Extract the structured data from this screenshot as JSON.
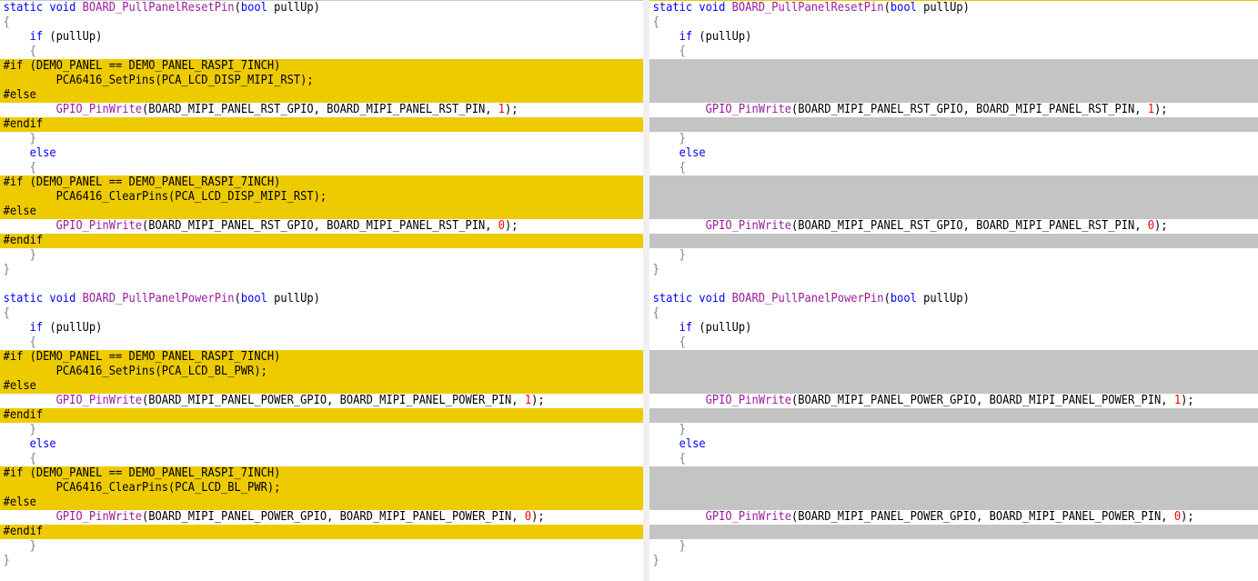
{
  "left": {
    "lines": [
      {
        "kind": "normal",
        "segs": [
          {
            "t": "static void ",
            "c": "kw"
          },
          {
            "t": "BOARD_PullPanelResetPin",
            "c": "fn"
          },
          {
            "t": "(",
            "c": ""
          },
          {
            "t": "bool",
            "c": "kw"
          },
          {
            "t": " pullUp)",
            "c": ""
          }
        ]
      },
      {
        "kind": "normal",
        "segs": [
          {
            "t": "{",
            "c": "gray"
          }
        ]
      },
      {
        "kind": "normal",
        "segs": [
          {
            "t": "    if",
            "c": "kw"
          },
          {
            "t": " (pullUp)",
            "c": ""
          }
        ]
      },
      {
        "kind": "normal",
        "segs": [
          {
            "t": "    {",
            "c": "gray"
          }
        ]
      },
      {
        "kind": "changed",
        "segs": [
          {
            "t": "#if (DEMO_PANEL == DEMO_PANEL_RASPI_7INCH)",
            "c": ""
          }
        ]
      },
      {
        "kind": "changed",
        "segs": [
          {
            "t": "        PCA6416_SetPins(PCA_LCD_DISP_MIPI_RST);",
            "c": ""
          }
        ]
      },
      {
        "kind": "changed",
        "segs": [
          {
            "t": "#else",
            "c": ""
          }
        ]
      },
      {
        "kind": "normal",
        "segs": [
          {
            "t": "        ",
            "c": ""
          },
          {
            "t": "GPIO_PinWrite",
            "c": "fn"
          },
          {
            "t": "(BOARD_MIPI_PANEL_RST_GPIO, BOARD_MIPI_PANEL_RST_PIN, ",
            "c": ""
          },
          {
            "t": "1",
            "c": "num"
          },
          {
            "t": ");",
            "c": ""
          }
        ]
      },
      {
        "kind": "changed",
        "segs": [
          {
            "t": "#endif",
            "c": ""
          }
        ]
      },
      {
        "kind": "normal",
        "segs": [
          {
            "t": "    }",
            "c": "gray"
          }
        ]
      },
      {
        "kind": "normal",
        "segs": [
          {
            "t": "    else",
            "c": "kw"
          }
        ]
      },
      {
        "kind": "normal",
        "segs": [
          {
            "t": "    {",
            "c": "gray"
          }
        ]
      },
      {
        "kind": "changed",
        "segs": [
          {
            "t": "#if (DEMO_PANEL == DEMO_PANEL_RASPI_7INCH)",
            "c": ""
          }
        ]
      },
      {
        "kind": "changed",
        "segs": [
          {
            "t": "        PCA6416_ClearPins(PCA_LCD_DISP_MIPI_RST);",
            "c": ""
          }
        ]
      },
      {
        "kind": "changed",
        "segs": [
          {
            "t": "#else",
            "c": ""
          }
        ]
      },
      {
        "kind": "normal",
        "segs": [
          {
            "t": "        ",
            "c": ""
          },
          {
            "t": "GPIO_PinWrite",
            "c": "fn"
          },
          {
            "t": "(BOARD_MIPI_PANEL_RST_GPIO, BOARD_MIPI_PANEL_RST_PIN, ",
            "c": ""
          },
          {
            "t": "0",
            "c": "num"
          },
          {
            "t": ");",
            "c": ""
          }
        ]
      },
      {
        "kind": "changed",
        "segs": [
          {
            "t": "#endif",
            "c": ""
          }
        ]
      },
      {
        "kind": "normal",
        "segs": [
          {
            "t": "    }",
            "c": "gray"
          }
        ]
      },
      {
        "kind": "normal",
        "segs": [
          {
            "t": "}",
            "c": "gray"
          }
        ]
      },
      {
        "kind": "normal",
        "segs": [
          {
            "t": "",
            "c": ""
          }
        ]
      },
      {
        "kind": "normal",
        "segs": [
          {
            "t": "static void ",
            "c": "kw"
          },
          {
            "t": "BOARD_PullPanelPowerPin",
            "c": "fn"
          },
          {
            "t": "(",
            "c": ""
          },
          {
            "t": "bool",
            "c": "kw"
          },
          {
            "t": " pullUp)",
            "c": ""
          }
        ]
      },
      {
        "kind": "normal",
        "segs": [
          {
            "t": "{",
            "c": "gray"
          }
        ]
      },
      {
        "kind": "normal",
        "segs": [
          {
            "t": "    if",
            "c": "kw"
          },
          {
            "t": " (pullUp)",
            "c": ""
          }
        ]
      },
      {
        "kind": "normal",
        "segs": [
          {
            "t": "    {",
            "c": "gray"
          }
        ]
      },
      {
        "kind": "changed",
        "segs": [
          {
            "t": "#if (DEMO_PANEL == DEMO_PANEL_RASPI_7INCH)",
            "c": ""
          }
        ]
      },
      {
        "kind": "changed",
        "segs": [
          {
            "t": "        PCA6416_SetPins(PCA_LCD_BL_PWR);",
            "c": ""
          }
        ]
      },
      {
        "kind": "changed",
        "segs": [
          {
            "t": "#else",
            "c": ""
          }
        ]
      },
      {
        "kind": "normal",
        "segs": [
          {
            "t": "        ",
            "c": ""
          },
          {
            "t": "GPIO_PinWrite",
            "c": "fn"
          },
          {
            "t": "(BOARD_MIPI_PANEL_POWER_GPIO, BOARD_MIPI_PANEL_POWER_PIN, ",
            "c": ""
          },
          {
            "t": "1",
            "c": "num"
          },
          {
            "t": ");",
            "c": ""
          }
        ]
      },
      {
        "kind": "changed",
        "segs": [
          {
            "t": "#endif",
            "c": ""
          }
        ]
      },
      {
        "kind": "normal",
        "segs": [
          {
            "t": "    }",
            "c": "gray"
          }
        ]
      },
      {
        "kind": "normal",
        "segs": [
          {
            "t": "    else",
            "c": "kw"
          }
        ]
      },
      {
        "kind": "normal",
        "segs": [
          {
            "t": "    {",
            "c": "gray"
          }
        ]
      },
      {
        "kind": "changed",
        "segs": [
          {
            "t": "#if (DEMO_PANEL == DEMO_PANEL_RASPI_7INCH)",
            "c": ""
          }
        ]
      },
      {
        "kind": "changed",
        "segs": [
          {
            "t": "        PCA6416_ClearPins(PCA_LCD_BL_PWR);",
            "c": ""
          }
        ]
      },
      {
        "kind": "changed",
        "segs": [
          {
            "t": "#else",
            "c": ""
          }
        ]
      },
      {
        "kind": "normal",
        "segs": [
          {
            "t": "        ",
            "c": ""
          },
          {
            "t": "GPIO_PinWrite",
            "c": "fn"
          },
          {
            "t": "(BOARD_MIPI_PANEL_POWER_GPIO, BOARD_MIPI_PANEL_POWER_PIN, ",
            "c": ""
          },
          {
            "t": "0",
            "c": "num"
          },
          {
            "t": ");",
            "c": ""
          }
        ]
      },
      {
        "kind": "changed",
        "segs": [
          {
            "t": "#endif",
            "c": ""
          }
        ]
      },
      {
        "kind": "normal",
        "segs": [
          {
            "t": "    }",
            "c": "gray"
          }
        ]
      },
      {
        "kind": "normal",
        "segs": [
          {
            "t": "}",
            "c": "gray"
          }
        ]
      }
    ]
  },
  "right": {
    "lines": [
      {
        "kind": "normal",
        "segs": [
          {
            "t": "static void ",
            "c": "kw"
          },
          {
            "t": "BOARD_PullPanelResetPin",
            "c": "fn"
          },
          {
            "t": "(",
            "c": ""
          },
          {
            "t": "bool",
            "c": "kw"
          },
          {
            "t": " pullUp)",
            "c": ""
          }
        ]
      },
      {
        "kind": "normal",
        "segs": [
          {
            "t": "{",
            "c": "gray"
          }
        ]
      },
      {
        "kind": "normal",
        "segs": [
          {
            "t": "    if",
            "c": "kw"
          },
          {
            "t": " (pullUp)",
            "c": ""
          }
        ]
      },
      {
        "kind": "normal",
        "segs": [
          {
            "t": "    {",
            "c": "gray"
          }
        ]
      },
      {
        "kind": "blank",
        "segs": []
      },
      {
        "kind": "blank",
        "segs": []
      },
      {
        "kind": "blank",
        "segs": []
      },
      {
        "kind": "normal",
        "segs": [
          {
            "t": "        ",
            "c": ""
          },
          {
            "t": "GPIO_PinWrite",
            "c": "fn"
          },
          {
            "t": "(BOARD_MIPI_PANEL_RST_GPIO, BOARD_MIPI_PANEL_RST_PIN, ",
            "c": ""
          },
          {
            "t": "1",
            "c": "num"
          },
          {
            "t": ");",
            "c": ""
          }
        ]
      },
      {
        "kind": "blank",
        "segs": []
      },
      {
        "kind": "normal",
        "segs": [
          {
            "t": "    }",
            "c": "gray"
          }
        ]
      },
      {
        "kind": "normal",
        "segs": [
          {
            "t": "    else",
            "c": "kw"
          }
        ]
      },
      {
        "kind": "normal",
        "segs": [
          {
            "t": "    {",
            "c": "gray"
          }
        ]
      },
      {
        "kind": "blank",
        "segs": []
      },
      {
        "kind": "blank",
        "segs": []
      },
      {
        "kind": "blank",
        "segs": []
      },
      {
        "kind": "normal",
        "segs": [
          {
            "t": "        ",
            "c": ""
          },
          {
            "t": "GPIO_PinWrite",
            "c": "fn"
          },
          {
            "t": "(BOARD_MIPI_PANEL_RST_GPIO, BOARD_MIPI_PANEL_RST_PIN, ",
            "c": ""
          },
          {
            "t": "0",
            "c": "num"
          },
          {
            "t": ");",
            "c": ""
          }
        ]
      },
      {
        "kind": "blank",
        "segs": []
      },
      {
        "kind": "normal",
        "segs": [
          {
            "t": "    }",
            "c": "gray"
          }
        ]
      },
      {
        "kind": "normal",
        "segs": [
          {
            "t": "}",
            "c": "gray"
          }
        ]
      },
      {
        "kind": "normal",
        "segs": [
          {
            "t": "",
            "c": ""
          }
        ]
      },
      {
        "kind": "normal",
        "segs": [
          {
            "t": "static void ",
            "c": "kw"
          },
          {
            "t": "BOARD_PullPanelPowerPin",
            "c": "fn"
          },
          {
            "t": "(",
            "c": ""
          },
          {
            "t": "bool",
            "c": "kw"
          },
          {
            "t": " pullUp)",
            "c": ""
          }
        ]
      },
      {
        "kind": "normal",
        "segs": [
          {
            "t": "{",
            "c": "gray"
          }
        ]
      },
      {
        "kind": "normal",
        "segs": [
          {
            "t": "    if",
            "c": "kw"
          },
          {
            "t": " (pullUp)",
            "c": ""
          }
        ]
      },
      {
        "kind": "normal",
        "segs": [
          {
            "t": "    {",
            "c": "gray"
          }
        ]
      },
      {
        "kind": "blank",
        "segs": []
      },
      {
        "kind": "blank",
        "segs": []
      },
      {
        "kind": "blank",
        "segs": []
      },
      {
        "kind": "normal",
        "segs": [
          {
            "t": "        ",
            "c": ""
          },
          {
            "t": "GPIO_PinWrite",
            "c": "fn"
          },
          {
            "t": "(BOARD_MIPI_PANEL_POWER_GPIO, BOARD_MIPI_PANEL_POWER_PIN, ",
            "c": ""
          },
          {
            "t": "1",
            "c": "num"
          },
          {
            "t": ");",
            "c": ""
          }
        ]
      },
      {
        "kind": "blank",
        "segs": []
      },
      {
        "kind": "normal",
        "segs": [
          {
            "t": "    }",
            "c": "gray"
          }
        ]
      },
      {
        "kind": "normal",
        "segs": [
          {
            "t": "    else",
            "c": "kw"
          }
        ]
      },
      {
        "kind": "normal",
        "segs": [
          {
            "t": "    {",
            "c": "gray"
          }
        ]
      },
      {
        "kind": "blank",
        "segs": []
      },
      {
        "kind": "blank",
        "segs": []
      },
      {
        "kind": "blank",
        "segs": []
      },
      {
        "kind": "normal",
        "segs": [
          {
            "t": "        ",
            "c": ""
          },
          {
            "t": "GPIO_PinWrite",
            "c": "fn"
          },
          {
            "t": "(BOARD_MIPI_PANEL_POWER_GPIO, BOARD_MIPI_PANEL_POWER_PIN, ",
            "c": ""
          },
          {
            "t": "0",
            "c": "num"
          },
          {
            "t": ");",
            "c": ""
          }
        ]
      },
      {
        "kind": "blank",
        "segs": []
      },
      {
        "kind": "normal",
        "segs": [
          {
            "t": "    }",
            "c": "gray"
          }
        ]
      },
      {
        "kind": "normal",
        "segs": [
          {
            "t": "}",
            "c": "gray"
          }
        ]
      }
    ]
  },
  "colors": {
    "changed_line": "#eecb00",
    "blank_line": "#c4c4c4",
    "keyword": "#0000ff",
    "function": "#9a1b9e",
    "number": "#ff0000"
  }
}
